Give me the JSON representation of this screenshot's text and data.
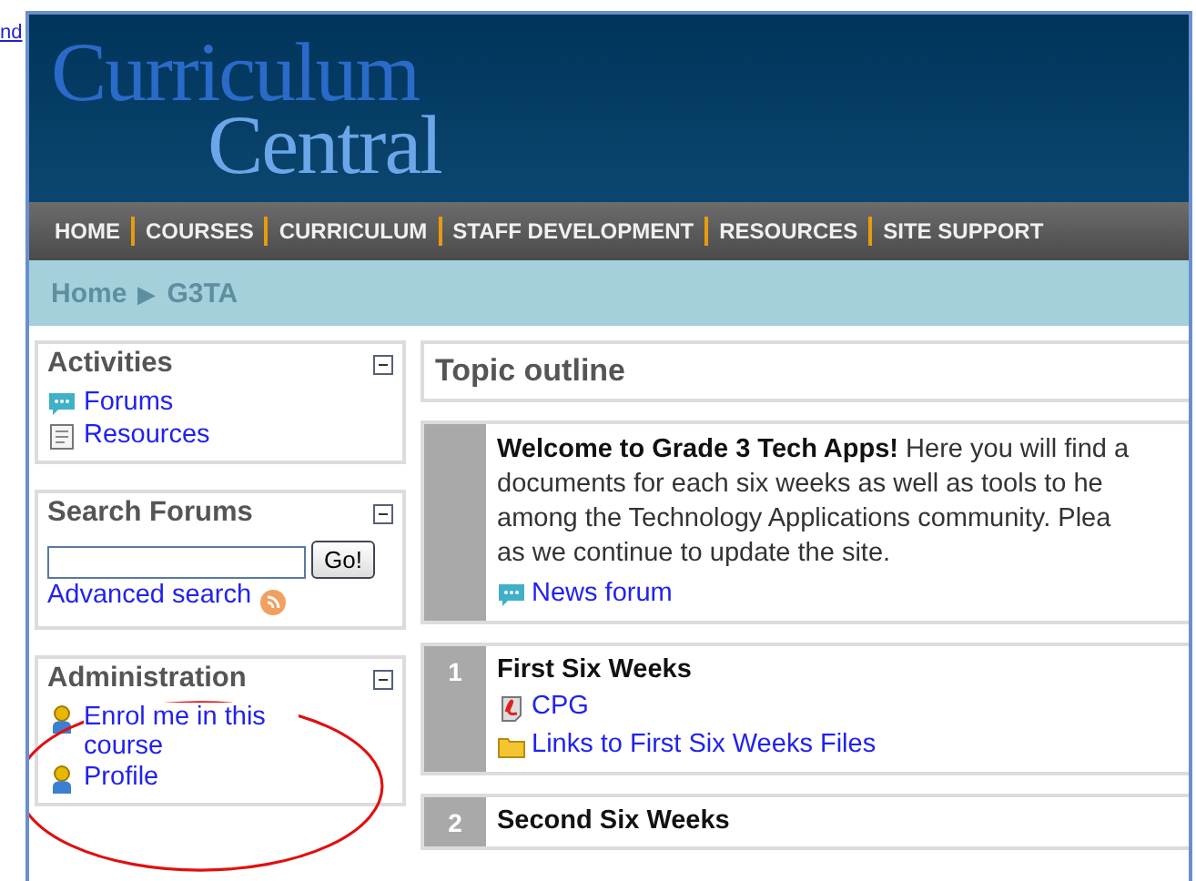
{
  "background_link": "nd",
  "logo": {
    "line_1": "Curriculum",
    "line_2": "Central"
  },
  "nav": [
    "HOME",
    "COURSES",
    "CURRICULUM",
    "STAFF DEVELOPMENT",
    "RESOURCES",
    "SITE SUPPORT"
  ],
  "breadcrumb": {
    "items": [
      "Home",
      "G3TA"
    ],
    "separator": "▶"
  },
  "blocks": [
    {
      "kind": "links",
      "title": "Activities",
      "items": [
        {
          "label": "Forums",
          "kind": "forum"
        },
        {
          "label": "Resources",
          "kind": "resource"
        }
      ]
    },
    {
      "kind": "search",
      "title": "Search Forums",
      "button": "Go!",
      "link": "Advanced search"
    },
    {
      "kind": "links",
      "title": "Administration",
      "items": [
        {
          "label": "Enrol me in this course",
          "kind": "user"
        },
        {
          "label": "Profile",
          "kind": "user"
        }
      ]
    }
  ],
  "topic_outline": {
    "title": "Topic outline",
    "sections": [
      {
        "summary_lines": [
          "**Welcome to Grade 3 Tech Apps!** Here you will find a",
          "documents for each six weeks as well as tools to he",
          "among the Technology Applications community. Plea",
          "as we continue to update the site."
        ],
        "items": [
          {
            "label": "News forum",
            "kind": "forum"
          }
        ]
      },
      {
        "number": "1",
        "title": "First Six Weeks",
        "items": [
          {
            "label": "CPG",
            "kind": "pdf"
          },
          {
            "label": "Links to First Six Weeks Files",
            "kind": "folder"
          }
        ]
      },
      {
        "number": "2",
        "title": "Second Six Weeks"
      }
    ]
  }
}
